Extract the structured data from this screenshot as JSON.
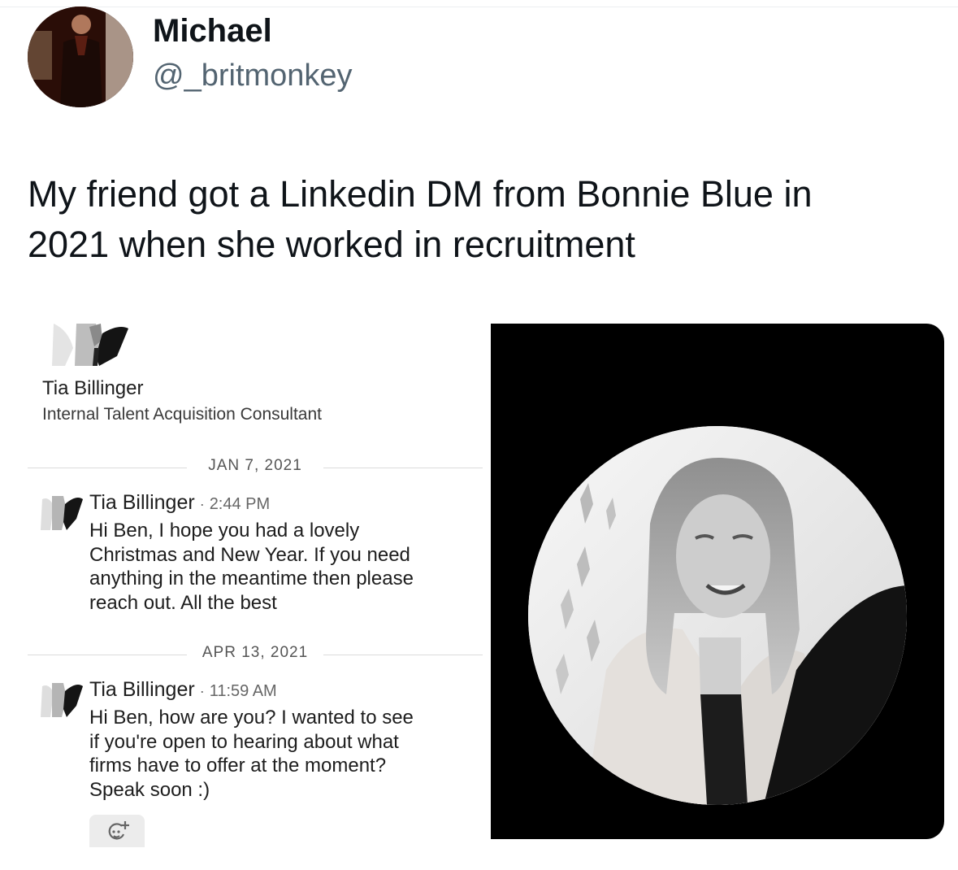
{
  "author": {
    "display_name": "Michael",
    "handle": "@_britmonkey"
  },
  "tweet": {
    "text_line_1": "My friend got a Linkedin DM from Bonnie Blue in",
    "text_line_2": "2021 when she worked in recruitment"
  },
  "linkedin": {
    "contact_name": "Tia Billinger",
    "contact_headline": "Internal Talent Acquisition Consultant",
    "messages": [
      {
        "date": "JAN 7, 2021",
        "sender": "Tia Billinger",
        "separator": "·",
        "time": "2:44 PM",
        "lines": [
          "Hi Ben, I hope you had a lovely",
          "Christmas and New Year. If you need",
          "anything in the meantime then please",
          "reach out. All the best"
        ]
      },
      {
        "date": "APR 13, 2021",
        "sender": "Tia Billinger",
        "separator": "·",
        "time": "11:59 AM",
        "lines": [
          "Hi Ben, how are you? I wanted to see",
          "if you're open to hearing about what",
          "firms have to offer at the moment?",
          "Speak soon :)"
        ]
      }
    ],
    "reaction_icon": "add-reaction-icon"
  },
  "colors": {
    "text_primary": "#0f1419",
    "text_secondary": "#536471",
    "photo_background": "#000000"
  }
}
